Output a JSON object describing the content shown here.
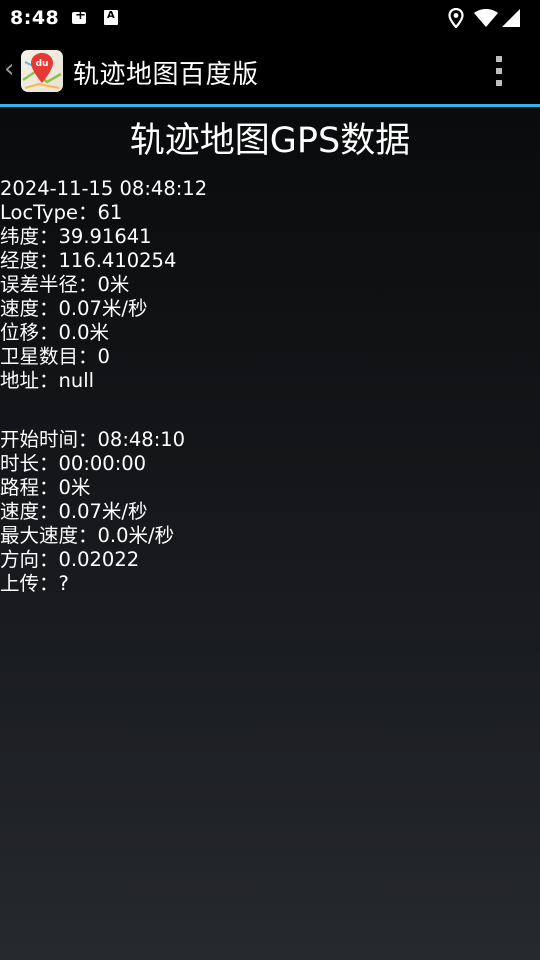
{
  "status_bar": {
    "time": "8:48",
    "icons": [
      "notification-plus-icon",
      "font-a-icon",
      "location-pin-icon",
      "wifi-icon",
      "signal-icon"
    ]
  },
  "action_bar": {
    "app_title": "轨迹地图百度版",
    "logo_text": "du",
    "back_icon": "chevron-left-icon",
    "menu_icon": "overflow-menu-icon",
    "accent_color": "#33b5e5"
  },
  "page": {
    "heading": "轨迹地图GPS数据"
  },
  "location_info": [
    "2024-11-15 08:48:12",
    "LocType：61",
    "纬度：39.91641",
    "经度：116.410254",
    "误差半径：0米",
    "速度：0.07米/秒",
    "位移：0.0米",
    "卫星数目：0",
    "地址：null"
  ],
  "track_info": [
    "开始时间：08:48:10",
    "时长：00:00:00",
    "路程：0米",
    "速度：0.07米/秒",
    "最大速度：0.0米/秒",
    "方向：0.02022",
    "上传：?"
  ]
}
